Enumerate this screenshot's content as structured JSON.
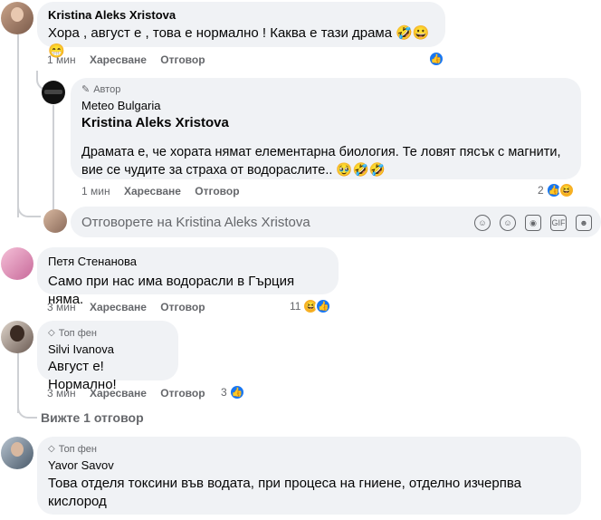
{
  "comment1": {
    "author": "Kristina Aleks Xristova",
    "text": "Хора , август е , това е нормално ! Каква е тази драма 🤣😀😁",
    "time": "1 мин",
    "like_label": "Харесване",
    "reply_label": "Отговор"
  },
  "reply1": {
    "author_badge": "Автор",
    "author": "Meteo Bulgaria",
    "mention": "Kristina Aleks Xristova",
    "text": "Драмата е, че хората нямат елементарна биология. Те ловят пясък с магнити, вие се чудите за страха от водораслите.. 🥹🤣🤣",
    "time": "1 мин",
    "like_label": "Харесване",
    "reply_label": "Отговор",
    "reaction_count": "2"
  },
  "reply_box": {
    "placeholder": "Отговорете на Kristina Aleks Xristova"
  },
  "comment2": {
    "author": "Петя Стенанова",
    "text": "Само при нас има водорасли в Гърция няма.",
    "time": "3 мин",
    "like_label": "Харесване",
    "reply_label": "Отговор",
    "reaction_count": "11"
  },
  "comment3": {
    "badge": "Топ фен",
    "author": "Silvi Ivanova",
    "text": "Август е!Нормално!",
    "time": "3 мин",
    "like_label": "Харесване",
    "reply_label": "Отговор",
    "reaction_count": "3",
    "view_replies": "Вижте 1 отговор"
  },
  "comment4": {
    "badge": "Топ фен",
    "author": "Yavor Savov",
    "text_line1": "Това отделя токсини във водата, при процеса на гниене, отделно изчерпва",
    "text_line2": "кислород"
  },
  "colors": {
    "bubble": "#f0f2f5",
    "secondary_text": "#65676b",
    "like_blue": "#1877f2",
    "haha_yellow": "#f7b125"
  }
}
